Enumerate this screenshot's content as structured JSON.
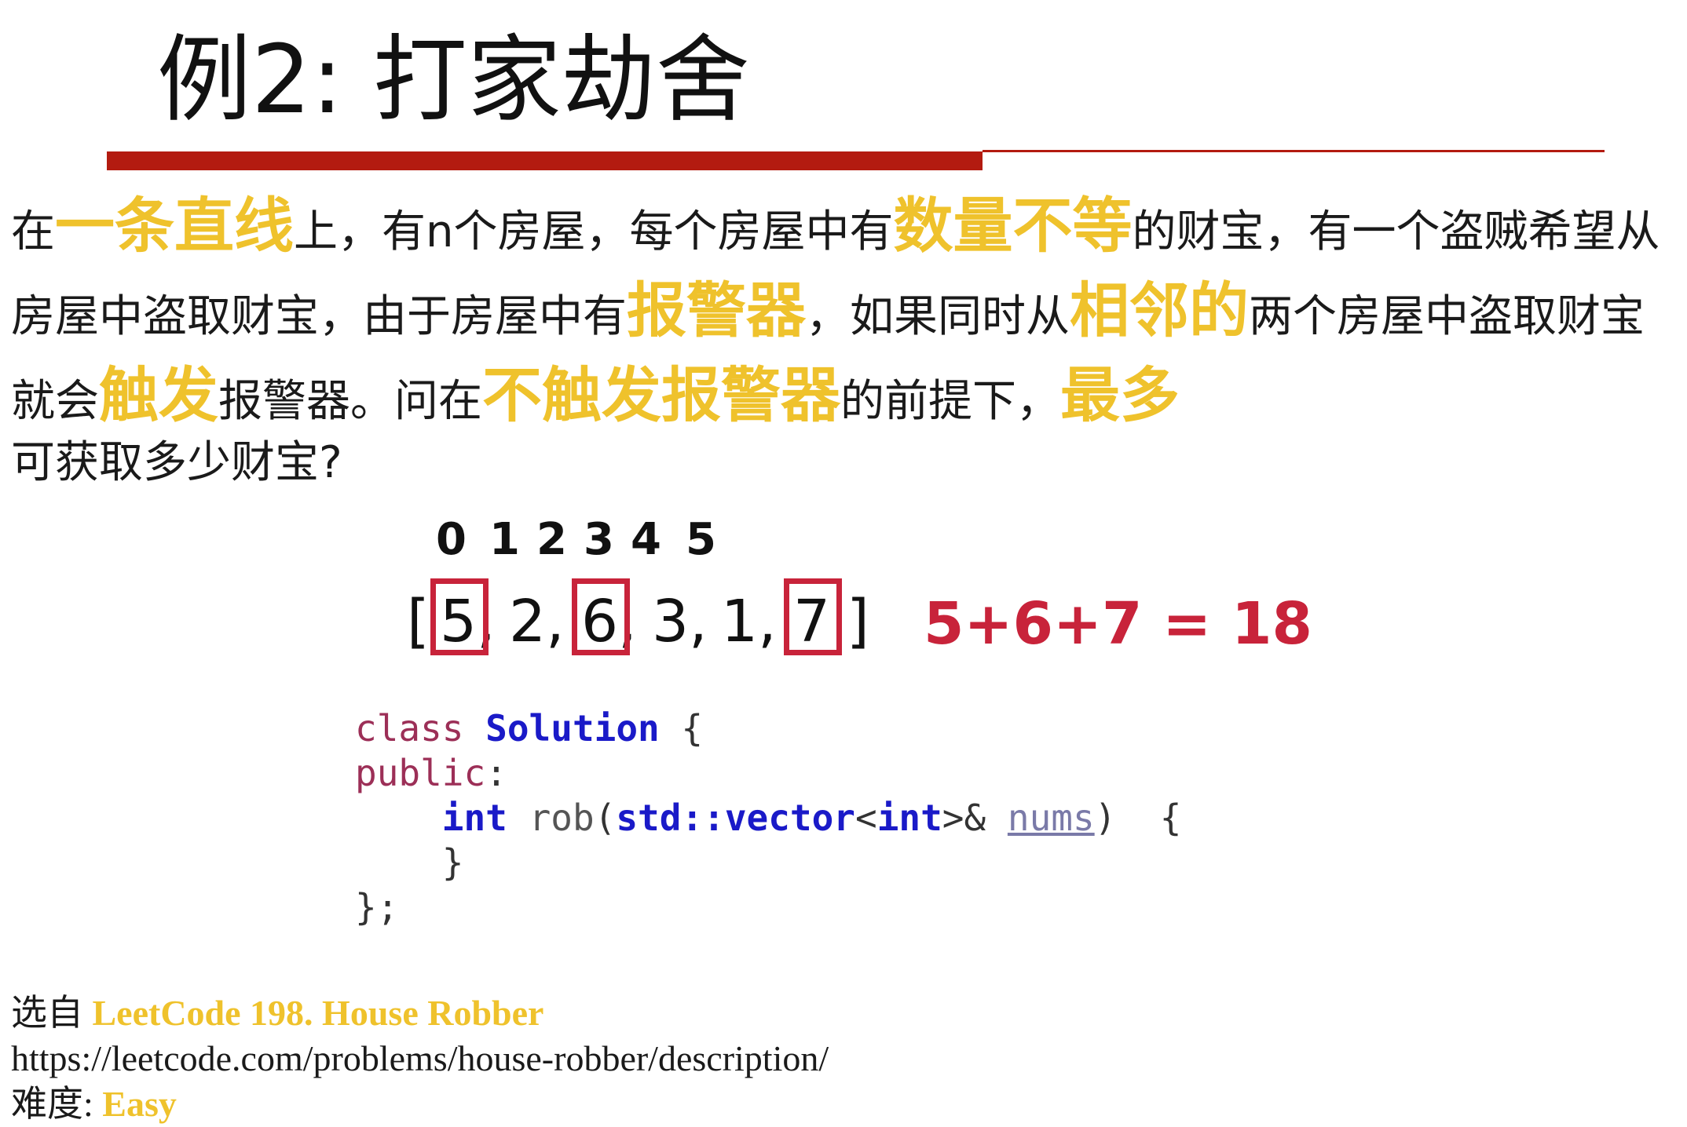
{
  "slide": {
    "title": "例2: 打家劫舍",
    "colors": {
      "title_rule": "#b31b10",
      "highlight": "#efc22c",
      "accent_red": "#c8233a"
    }
  },
  "description": {
    "segments": [
      {
        "text": "在",
        "highlight": false
      },
      {
        "text": "一条直线",
        "highlight": true
      },
      {
        "text": "上，有n个房屋，每个房屋中有",
        "highlight": false
      },
      {
        "text": "数量不等",
        "highlight": true
      },
      {
        "text": "的财宝，有一个盗贼希望从房屋中盗取财宝，由于房屋中有",
        "highlight": false
      },
      {
        "text": "报警器",
        "highlight": true
      },
      {
        "text": "，如果同时从",
        "highlight": false
      },
      {
        "text": "相邻的",
        "highlight": true
      },
      {
        "text": "两个房屋中盗取财宝就会",
        "highlight": false
      },
      {
        "text": "触发",
        "highlight": true
      },
      {
        "text": "报警器。问在",
        "highlight": false
      },
      {
        "text": "不触发报警器",
        "highlight": true
      },
      {
        "text": "的前提下，",
        "highlight": false
      },
      {
        "text": "最多",
        "highlight": true
      },
      {
        "text": "可获取多少财宝?",
        "highlight": false,
        "newline": true
      }
    ]
  },
  "illustration": {
    "indices": [
      "0",
      "1",
      "2",
      "3",
      "4",
      "5"
    ],
    "open_bracket": "[",
    "close_bracket": "]",
    "values": [
      "5,",
      "2,",
      "6,",
      "3,",
      "1,",
      "7"
    ],
    "selected": [
      true,
      false,
      true,
      false,
      false,
      true
    ],
    "sum_text": "5+6+7 = 18"
  },
  "code": {
    "lines": [
      [
        {
          "t": "class ",
          "c": "kw"
        },
        {
          "t": "Solution",
          "c": "ty"
        },
        {
          "t": " {",
          "c": "pl"
        }
      ],
      [
        {
          "t": "public",
          "c": "kw"
        },
        {
          "t": ":",
          "c": "pl"
        }
      ],
      [
        {
          "t": "    ",
          "c": "pl"
        },
        {
          "t": "int",
          "c": "ty"
        },
        {
          "t": " rob",
          "c": "pu"
        },
        {
          "t": "(",
          "c": "pl"
        },
        {
          "t": "std::vector",
          "c": "ty"
        },
        {
          "t": "<",
          "c": "pl"
        },
        {
          "t": "int",
          "c": "ty"
        },
        {
          "t": ">& ",
          "c": "pl"
        },
        {
          "t": "nums",
          "c": "prm"
        },
        {
          "t": ")  {",
          "c": "pl"
        }
      ],
      [
        {
          "t": "    }",
          "c": "pl"
        }
      ],
      [
        {
          "t": "};",
          "c": "pl"
        }
      ]
    ]
  },
  "footer": {
    "source_label": "选自",
    "source_name": "LeetCode 198. House Robber",
    "url": "https://leetcode.com/problems/house-robber/description/",
    "difficulty_label": "难度:",
    "difficulty_value": "Easy"
  }
}
